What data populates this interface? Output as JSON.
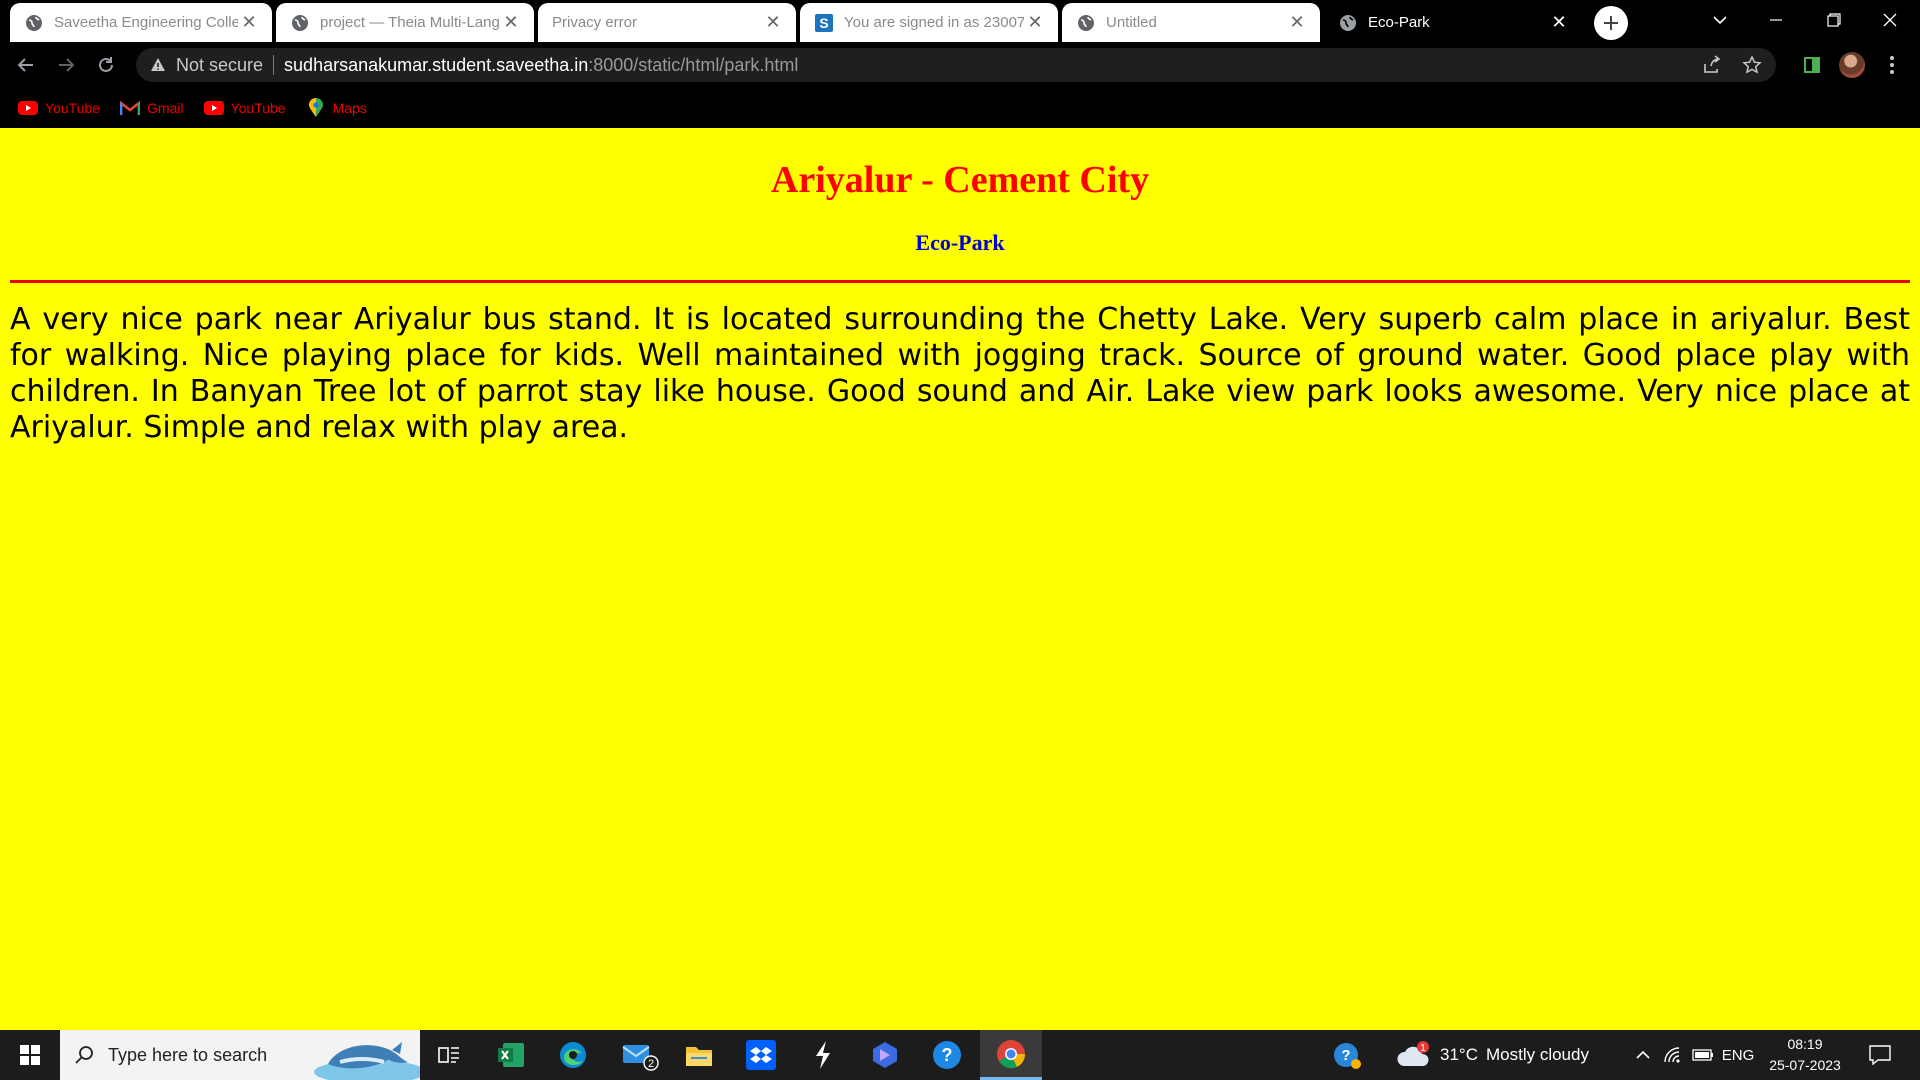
{
  "browser": {
    "tabs": [
      {
        "title": "Saveetha Engineering Colle",
        "favicon": "globe-icon",
        "active": false
      },
      {
        "title": "project — Theia Multi-Lang",
        "favicon": "globe-icon",
        "active": false
      },
      {
        "title": "Privacy error",
        "favicon": "none",
        "active": false
      },
      {
        "title": "You are signed in as 23007",
        "favicon": "s-logo-icon",
        "active": false
      },
      {
        "title": "Untitled",
        "favicon": "globe-icon",
        "active": false
      },
      {
        "title": "Eco-Park",
        "favicon": "globe-icon",
        "active": true
      }
    ],
    "close_glyph": "✕",
    "address": {
      "security_label": "Not secure",
      "host": "sudharsanakumar.student.saveetha.in",
      "path": ":8000/static/html/park.html"
    },
    "bookmarks": [
      {
        "label": "YouTube",
        "icon": "youtube-icon"
      },
      {
        "label": "Gmail",
        "icon": "gmail-icon"
      },
      {
        "label": "YouTube",
        "icon": "youtube-icon"
      },
      {
        "label": "Maps",
        "icon": "maps-icon"
      }
    ]
  },
  "page": {
    "heading": "Ariyalur - Cement City",
    "subheading": "Eco-Park",
    "body": "A very nice park near Ariyalur bus stand. It is located surrounding the Chetty Lake. Very superb calm place in ariyalur. Best for walking. Nice playing place for kids. Well maintained with jogging track. Source of ground water. Good place play with children. In Banyan Tree lot of parrot stay like house. Good sound and Air. Lake view park looks awesome. Very nice place at Ariyalur. Simple and relax with play area.",
    "background_color": "#ffff00",
    "heading_color": "#ff0000",
    "subheading_color": "#0000d0",
    "rule_color": "#ee0000"
  },
  "taskbar": {
    "search_placeholder": "Type here to search",
    "mail_badge": "2",
    "weather": {
      "temp": "31°C",
      "condition": "Mostly cloudy",
      "alert": "1"
    },
    "language": "ENG",
    "time": "08:19",
    "date": "25-07-2023"
  }
}
